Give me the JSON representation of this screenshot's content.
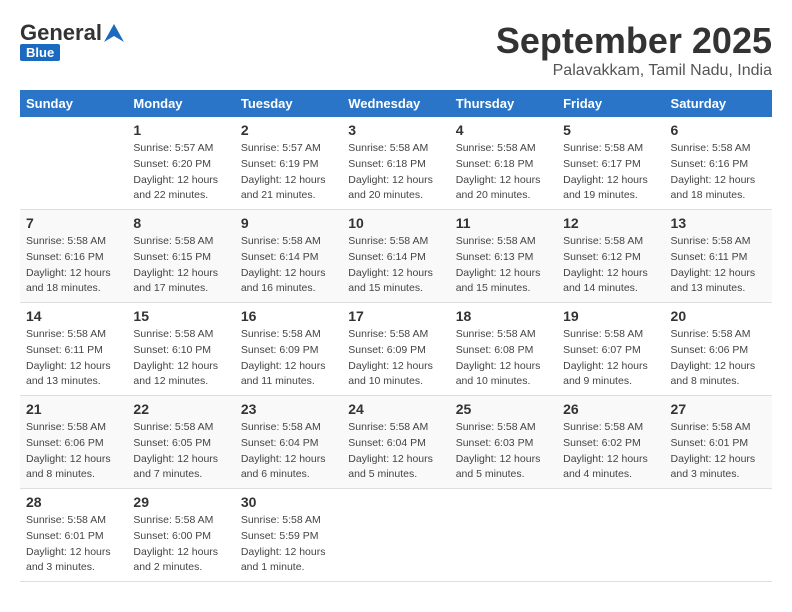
{
  "header": {
    "logo_general": "General",
    "logo_blue": "Blue",
    "month_title": "September 2025",
    "location": "Palavakkam, Tamil Nadu, India"
  },
  "days_of_week": [
    "Sunday",
    "Monday",
    "Tuesday",
    "Wednesday",
    "Thursday",
    "Friday",
    "Saturday"
  ],
  "weeks": [
    [
      {
        "day": "",
        "info": ""
      },
      {
        "day": "1",
        "info": "Sunrise: 5:57 AM\nSunset: 6:20 PM\nDaylight: 12 hours\nand 22 minutes."
      },
      {
        "day": "2",
        "info": "Sunrise: 5:57 AM\nSunset: 6:19 PM\nDaylight: 12 hours\nand 21 minutes."
      },
      {
        "day": "3",
        "info": "Sunrise: 5:58 AM\nSunset: 6:18 PM\nDaylight: 12 hours\nand 20 minutes."
      },
      {
        "day": "4",
        "info": "Sunrise: 5:58 AM\nSunset: 6:18 PM\nDaylight: 12 hours\nand 20 minutes."
      },
      {
        "day": "5",
        "info": "Sunrise: 5:58 AM\nSunset: 6:17 PM\nDaylight: 12 hours\nand 19 minutes."
      },
      {
        "day": "6",
        "info": "Sunrise: 5:58 AM\nSunset: 6:16 PM\nDaylight: 12 hours\nand 18 minutes."
      }
    ],
    [
      {
        "day": "7",
        "info": "Sunrise: 5:58 AM\nSunset: 6:16 PM\nDaylight: 12 hours\nand 18 minutes."
      },
      {
        "day": "8",
        "info": "Sunrise: 5:58 AM\nSunset: 6:15 PM\nDaylight: 12 hours\nand 17 minutes."
      },
      {
        "day": "9",
        "info": "Sunrise: 5:58 AM\nSunset: 6:14 PM\nDaylight: 12 hours\nand 16 minutes."
      },
      {
        "day": "10",
        "info": "Sunrise: 5:58 AM\nSunset: 6:14 PM\nDaylight: 12 hours\nand 15 minutes."
      },
      {
        "day": "11",
        "info": "Sunrise: 5:58 AM\nSunset: 6:13 PM\nDaylight: 12 hours\nand 15 minutes."
      },
      {
        "day": "12",
        "info": "Sunrise: 5:58 AM\nSunset: 6:12 PM\nDaylight: 12 hours\nand 14 minutes."
      },
      {
        "day": "13",
        "info": "Sunrise: 5:58 AM\nSunset: 6:11 PM\nDaylight: 12 hours\nand 13 minutes."
      }
    ],
    [
      {
        "day": "14",
        "info": "Sunrise: 5:58 AM\nSunset: 6:11 PM\nDaylight: 12 hours\nand 13 minutes."
      },
      {
        "day": "15",
        "info": "Sunrise: 5:58 AM\nSunset: 6:10 PM\nDaylight: 12 hours\nand 12 minutes."
      },
      {
        "day": "16",
        "info": "Sunrise: 5:58 AM\nSunset: 6:09 PM\nDaylight: 12 hours\nand 11 minutes."
      },
      {
        "day": "17",
        "info": "Sunrise: 5:58 AM\nSunset: 6:09 PM\nDaylight: 12 hours\nand 10 minutes."
      },
      {
        "day": "18",
        "info": "Sunrise: 5:58 AM\nSunset: 6:08 PM\nDaylight: 12 hours\nand 10 minutes."
      },
      {
        "day": "19",
        "info": "Sunrise: 5:58 AM\nSunset: 6:07 PM\nDaylight: 12 hours\nand 9 minutes."
      },
      {
        "day": "20",
        "info": "Sunrise: 5:58 AM\nSunset: 6:06 PM\nDaylight: 12 hours\nand 8 minutes."
      }
    ],
    [
      {
        "day": "21",
        "info": "Sunrise: 5:58 AM\nSunset: 6:06 PM\nDaylight: 12 hours\nand 8 minutes."
      },
      {
        "day": "22",
        "info": "Sunrise: 5:58 AM\nSunset: 6:05 PM\nDaylight: 12 hours\nand 7 minutes."
      },
      {
        "day": "23",
        "info": "Sunrise: 5:58 AM\nSunset: 6:04 PM\nDaylight: 12 hours\nand 6 minutes."
      },
      {
        "day": "24",
        "info": "Sunrise: 5:58 AM\nSunset: 6:04 PM\nDaylight: 12 hours\nand 5 minutes."
      },
      {
        "day": "25",
        "info": "Sunrise: 5:58 AM\nSunset: 6:03 PM\nDaylight: 12 hours\nand 5 minutes."
      },
      {
        "day": "26",
        "info": "Sunrise: 5:58 AM\nSunset: 6:02 PM\nDaylight: 12 hours\nand 4 minutes."
      },
      {
        "day": "27",
        "info": "Sunrise: 5:58 AM\nSunset: 6:01 PM\nDaylight: 12 hours\nand 3 minutes."
      }
    ],
    [
      {
        "day": "28",
        "info": "Sunrise: 5:58 AM\nSunset: 6:01 PM\nDaylight: 12 hours\nand 3 minutes."
      },
      {
        "day": "29",
        "info": "Sunrise: 5:58 AM\nSunset: 6:00 PM\nDaylight: 12 hours\nand 2 minutes."
      },
      {
        "day": "30",
        "info": "Sunrise: 5:58 AM\nSunset: 5:59 PM\nDaylight: 12 hours\nand 1 minute."
      },
      {
        "day": "",
        "info": ""
      },
      {
        "day": "",
        "info": ""
      },
      {
        "day": "",
        "info": ""
      },
      {
        "day": "",
        "info": ""
      }
    ]
  ]
}
